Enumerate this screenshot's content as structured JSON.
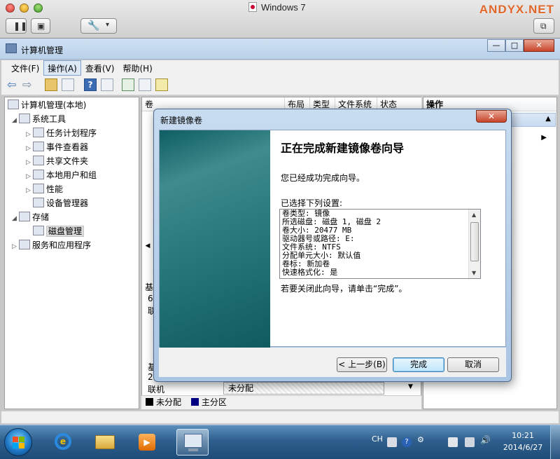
{
  "host": {
    "title": "Windows 7",
    "watermark": "ANDYX.NET"
  },
  "window": {
    "title": "计算机管理",
    "caption_min": "—",
    "caption_max": "□",
    "caption_close": "✕"
  },
  "menu": {
    "items": [
      "文件(F)",
      "操作(A)",
      "查看(V)",
      "帮助(H)"
    ]
  },
  "tree": {
    "root": "计算机管理(本地)",
    "system_tools": "系统工具",
    "task_scheduler": "任务计划程序",
    "event_viewer": "事件查看器",
    "shared_folders": "共享文件夹",
    "local_users": "本地用户和组",
    "performance": "性能",
    "device_manager": "设备管理器",
    "storage": "存储",
    "disk_management": "磁盘管理",
    "services_apps": "服务和应用程序"
  },
  "center": {
    "col_volume": "卷",
    "col_layout": "布局",
    "col_type": "类型",
    "col_fs": "文件系统",
    "col_status": "状态",
    "disk_label_partial_1": "基",
    "disk_label_partial_2": "6",
    "disk_label_partial_3": "联",
    "disk_label_partial_4": "基",
    "disk_label_partial_5": "2",
    "online_label": "联机",
    "unallocated": "未分配",
    "legend_unallocated": "未分配",
    "legend_primary": "主分区"
  },
  "actions": {
    "header": "操作"
  },
  "dialog": {
    "title": "新建镜像卷",
    "close": "✕",
    "heading": "正在完成新建镜像卷向导",
    "success_text": "您已经成功完成向导。",
    "selected_label": "已选择下列设置:",
    "settings": [
      "卷类型: 镜像",
      "所选磁盘: 磁盘 1, 磁盘 2",
      "卷大小: 20477 MB",
      "驱动器号或路径: E:",
      "文件系统: NTFS",
      "分配单元大小: 默认值",
      "卷标: 新加卷",
      "快速格式化: 是"
    ],
    "close_hint": "若要关闭此向导，请单击“完成”。",
    "back_button": "< 上一步(B)",
    "finish_button": "完成",
    "cancel_button": "取消"
  },
  "taskbar": {
    "lang": "CH",
    "time": "10:21",
    "date": "2014/6/27"
  },
  "colors": {
    "legend_unallocated": "#000000",
    "legend_primary": "#000080",
    "wizard_side": "#2d7d80",
    "watermark": "#e0662a"
  },
  "icons": [
    "search-icon",
    "back-arrow-icon",
    "forward-arrow-icon",
    "help-icon",
    "refresh-icon",
    "export-icon",
    "properties-icon",
    "folder-icon",
    "computer-icon",
    "clock-icon",
    "event-icon",
    "share-icon",
    "users-icon",
    "performance-icon",
    "device-icon",
    "storage-icon",
    "disk-icon",
    "services-icon",
    "ie-icon",
    "explorer-icon",
    "media-player-icon",
    "mmc-icon"
  ]
}
